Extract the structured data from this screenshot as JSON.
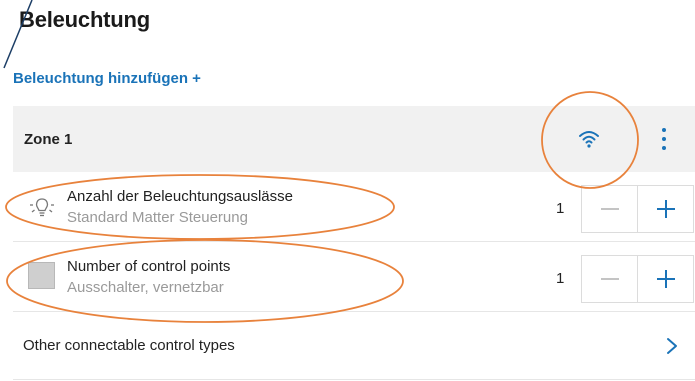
{
  "page": {
    "title": "Beleuchtung",
    "add_link": "Beleuchtung hinzufügen +"
  },
  "zone": {
    "label": "Zone 1",
    "status_icon": "wifi-icon",
    "menu_icon": "kebab-menu-icon"
  },
  "rows": [
    {
      "title": "Anzahl der Beleuchtungsauslässe",
      "subtitle": "Standard Matter Steuerung",
      "quantity": "1",
      "icon": "light-bulb-icon"
    },
    {
      "title": "Number of control points",
      "subtitle": "Ausschalter, vernetzbar",
      "quantity": "1",
      "icon": "switch-icon"
    }
  ],
  "other": {
    "label": "Other connectable control types",
    "icon": "chevron-right-icon"
  },
  "colors": {
    "accent": "#1a73b8",
    "annotation": "#e8823c",
    "header_bg": "#f1f1f1"
  }
}
